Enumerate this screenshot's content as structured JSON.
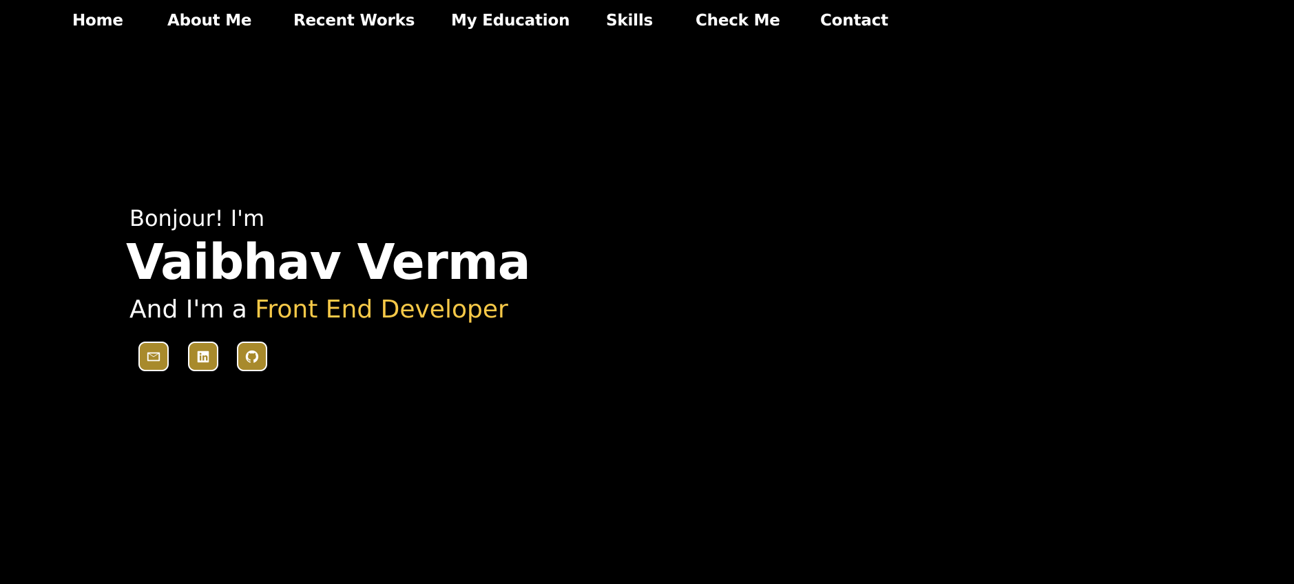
{
  "nav": {
    "items": [
      {
        "label": "Home"
      },
      {
        "label": "About Me"
      },
      {
        "label": "Recent Works"
      },
      {
        "label": "My Education"
      },
      {
        "label": "Skills"
      },
      {
        "label": "Check Me"
      },
      {
        "label": "Contact"
      }
    ]
  },
  "hero": {
    "greeting": "Bonjour! I'm",
    "name": "Vaibhav Verma",
    "role_prefix": "And I'm a",
    "role": "Front End Developer"
  },
  "social": {
    "icons": [
      "mail-icon",
      "linkedin-icon",
      "github-icon"
    ]
  },
  "colors": {
    "background": "#000000",
    "text": "#ffffff",
    "accent": "#f7c948",
    "social_button": "#a88a2c"
  }
}
